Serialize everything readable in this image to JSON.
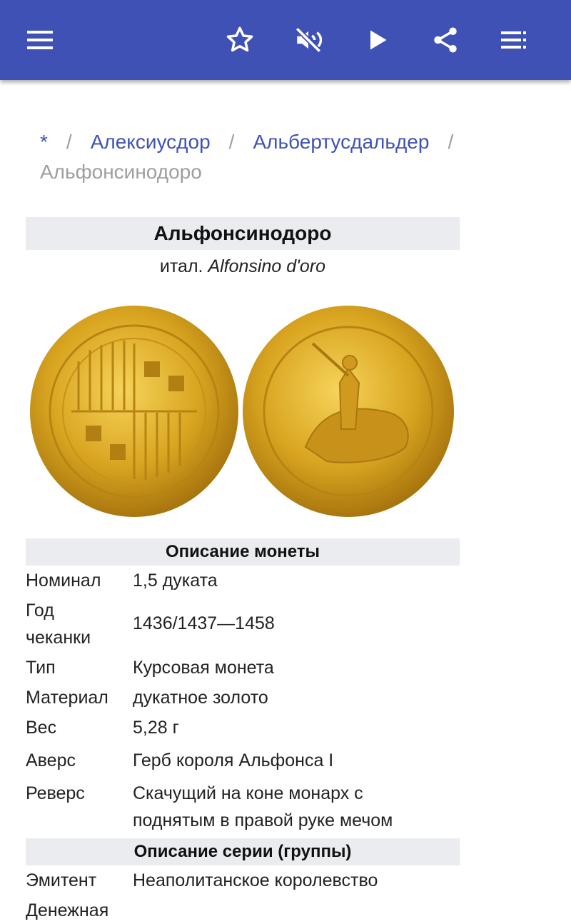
{
  "appbar": {
    "color": "#3f51b5",
    "icons": [
      "menu-icon",
      "star-icon",
      "volume-off-icon",
      "play-icon",
      "share-icon",
      "list-icon"
    ]
  },
  "breadcrumb": {
    "root": "*",
    "separator": "/",
    "link1": "Алексиусдор",
    "link2": "Альбертусдальдер",
    "current": "Альфонсинодоро"
  },
  "infobox": {
    "title": "Альфонсинодоро",
    "subtitle_prefix": "итал.",
    "subtitle_italic": "Alfonsino d'oro",
    "coin_description_header": "Описание монеты",
    "rows": [
      {
        "label": "Номинал",
        "value": "1,5 дуката"
      },
      {
        "label_line1": "Год",
        "label_line2": "чеканки",
        "value": "1436/1437—1458"
      },
      {
        "label": "Тип",
        "value": "Курсовая монета"
      },
      {
        "label": "Материал",
        "value": "дукатное золото"
      },
      {
        "label": "Вес",
        "value": "5,28 г"
      },
      {
        "label": "Аверс",
        "value": "Герб короля Альфонса I"
      },
      {
        "label": "Реверс",
        "value_line1": "Скачущий на коне монарх с",
        "value_line2": "поднятым в правой руке мечом"
      }
    ],
    "series_header": "Описание серии (группы)",
    "series_rows": [
      {
        "label": "Эмитент",
        "value": "Неаполитанское королевство"
      },
      {
        "label": "Денежная",
        "value": ""
      }
    ]
  }
}
